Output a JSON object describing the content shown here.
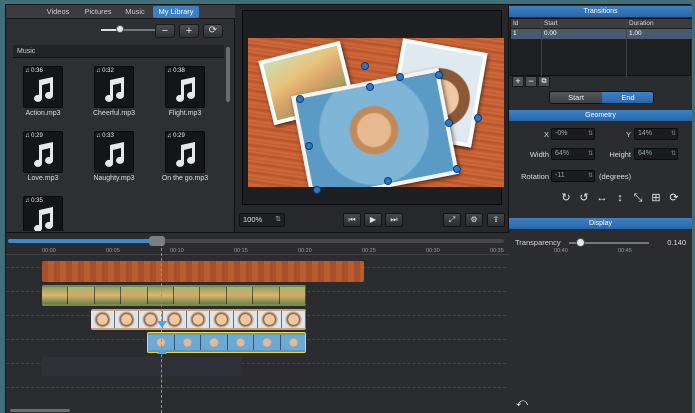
{
  "library": {
    "tabs": [
      "Videos",
      "Pictures",
      "Music",
      "My Library"
    ],
    "active_tab": "My Library",
    "section_title": "Music",
    "volume_fraction": 0.32,
    "buttons": {
      "minus": "−",
      "plus": "+",
      "refresh": "⟳"
    },
    "items": [
      {
        "name": "Action.mp3",
        "duration": "♫ 0:36"
      },
      {
        "name": "Cheerful.mp3",
        "duration": "♫ 0:32"
      },
      {
        "name": "Flight.mp3",
        "duration": "♫ 0:38"
      },
      {
        "name": "Love.mp3",
        "duration": "♫ 0:29"
      },
      {
        "name": "Naughty.mp3",
        "duration": "♫ 0:33"
      },
      {
        "name": "On the go.mp3",
        "duration": "♫ 0:29"
      },
      {
        "name": "",
        "duration": "♫ 0:35"
      }
    ]
  },
  "preview": {
    "zoom": "100%",
    "buttons": {
      "prev": "⏮",
      "play": "▶",
      "next": "⏭",
      "fullscreen": "⤢",
      "settings": "⚙",
      "share": "⇪"
    }
  },
  "inspector": {
    "transitions_title": "Transitions",
    "table": {
      "headers": [
        "Id",
        "Start",
        "Duration"
      ],
      "rows": [
        [
          "1",
          "0.00",
          "1.00"
        ]
      ]
    },
    "table_buttons": [
      "+",
      "−",
      "⧉"
    ],
    "segment": {
      "start": "Start",
      "end": "End",
      "selected": "End"
    },
    "geometry_title": "Geometry",
    "geometry": {
      "x_label": "X",
      "x_value": "-0%",
      "y_label": "Y",
      "y_value": "14%",
      "width_label": "Width",
      "width_value": "64%",
      "height_label": "Height",
      "height_value": "64%",
      "rotation_label": "Rotation",
      "rotation_value": "-11",
      "rotation_unit": "(degrees)"
    },
    "geometry_icons": [
      "↻",
      "↺",
      "↔",
      "↕",
      "⤡",
      "⊞",
      "⟳"
    ],
    "display_title": "Display",
    "transparency_label": "Transparency",
    "transparency_value": "0.140",
    "undo": "⤺"
  },
  "timeline": {
    "progress_fraction": 0.3,
    "ticks": [
      "00:00",
      "00:05",
      "00:10",
      "00:15",
      "00:20",
      "00:25",
      "00:30",
      "00:35",
      "00:40",
      "00:45"
    ]
  },
  "colors": {
    "accent": "#3b7fc4",
    "wood": "#c05a2e",
    "clip_selected": "#f5d63c"
  }
}
